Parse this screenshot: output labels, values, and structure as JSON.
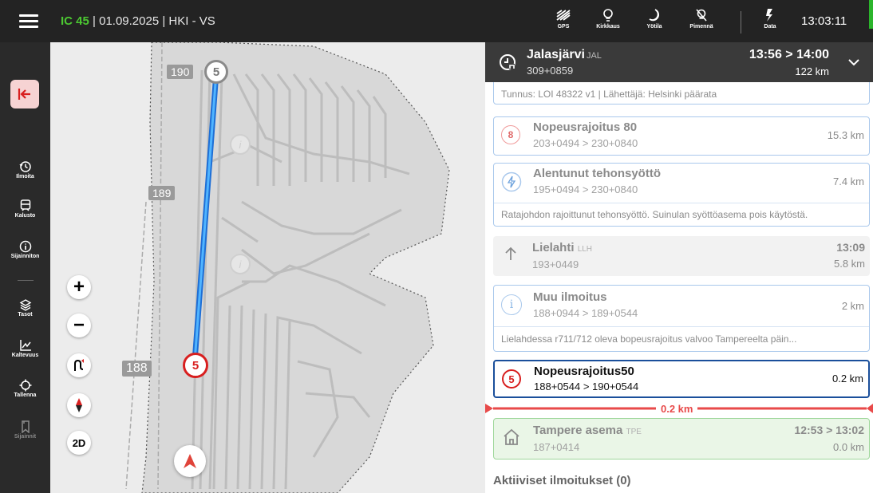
{
  "topbar": {
    "train_no": "IC 45",
    "train_rest": "| 01.09.2025 | HKI - VS",
    "status": [
      {
        "label": "GPS",
        "icon": "gps-signal-icon"
      },
      {
        "label": "Kirkkaus",
        "icon": "brightness-bulb-icon"
      },
      {
        "label": "Yötila",
        "icon": "night-mode-icon"
      },
      {
        "label": "Pimennä",
        "icon": "dim-off-icon"
      },
      {
        "label": "Data",
        "icon": "data-transfer-icon"
      }
    ],
    "clock": "13:03:11"
  },
  "sidebar": {
    "items": [
      {
        "label": "Ilmoita",
        "icon": "history-report-icon"
      },
      {
        "label": "Kalusto",
        "icon": "train-icon"
      },
      {
        "label": "Sijainniton",
        "icon": "info-icon"
      },
      {
        "label": "Tasot",
        "icon": "layers-icon"
      },
      {
        "label": "Kaltevuus",
        "icon": "gradient-chart-icon"
      },
      {
        "label": "Tallenna",
        "icon": "crosshair-icon"
      },
      {
        "label": "Sijainnit",
        "icon": "bookmark-icon"
      }
    ]
  },
  "map": {
    "km_labels": [
      "190",
      "189",
      "188"
    ],
    "signs": {
      "top": "5",
      "bottom": "5"
    },
    "controls": {
      "zoom_in": "+",
      "zoom_out": "−",
      "mode": "2D"
    }
  },
  "panel": {
    "station": {
      "name": "Jalasjärvi",
      "code": "JAL",
      "position": "309+0859",
      "time": "13:56 > 14:00",
      "distance": "122 km"
    },
    "partial_note": "Tunnus: LOI 48322 v1 | Lähettäjä: Helsinki päärata",
    "cards": [
      {
        "icon": "8",
        "title": "Nopeusrajoitus 80",
        "sub": "203+0494 > 230+0840",
        "right": "15.3 km"
      },
      {
        "icon": "lightning",
        "title": "Alentunut tehonsyöttö",
        "sub": "195+0494 > 230+0840",
        "right": "7.4 km",
        "note": "Ratajohdon rajoittunut tehonsyöttö. Suinulan syöttöasema pois käytöstä."
      },
      {
        "icon": "arrow",
        "title": "Lielahti",
        "code": "LLH",
        "sub": "193+0449",
        "right": "13:09",
        "right2": "5.8 km"
      },
      {
        "icon": "i",
        "title": "Muu ilmoitus",
        "sub": "188+0944 > 189+0544",
        "right": "2 km",
        "note": "Lielahdessa r711/712 oleva bopeusrajoitus valvoo Tampereelta päin..."
      },
      {
        "icon": "5",
        "title": "Nopeusrajoitus50",
        "sub": "188+0544 > 190+0544",
        "right": "0.2 km"
      }
    ],
    "distance_marker": "0.2 km",
    "last_station": {
      "title": "Tampere asema",
      "code": "TPE",
      "sub": "187+0414",
      "right": "12:53 > 13:02",
      "right2": "0.0 km"
    },
    "footer": "Aktiiviset ilmoitukset (0)"
  },
  "colors": {
    "accent_red": "#d81f1f",
    "accent_green": "#4cc832",
    "route_blue": "#2f8ff0",
    "card_border": "#a9c8ec",
    "active_border": "#1a4f9b"
  }
}
